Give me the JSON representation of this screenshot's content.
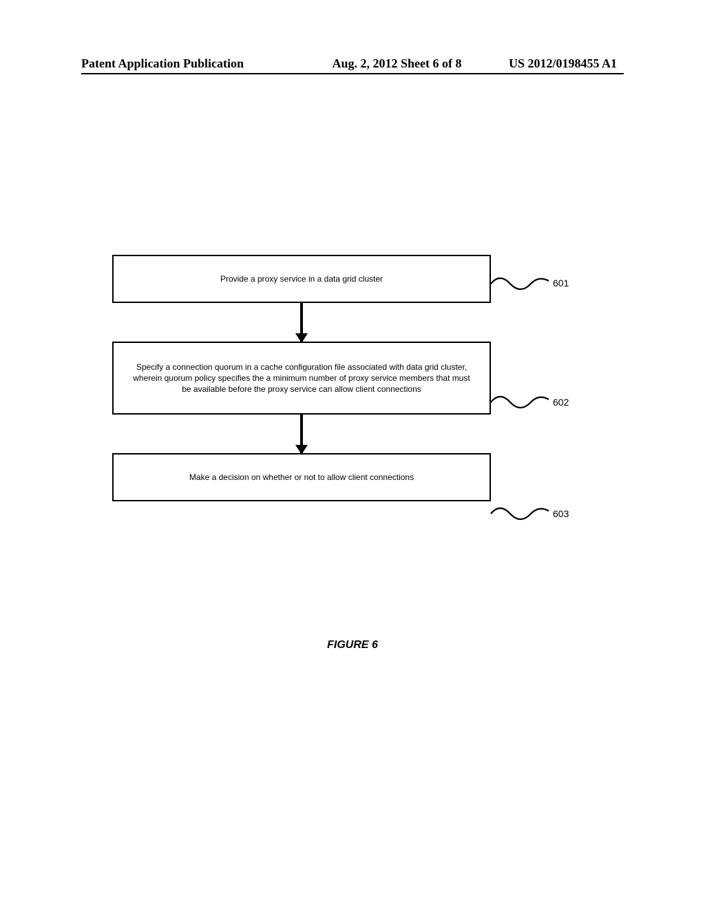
{
  "header": {
    "left": "Patent Application Publication",
    "center": "Aug. 2, 2012 Sheet 6 of 8",
    "right": "US 2012/0198455 A1"
  },
  "boxes": {
    "b1": "Provide a proxy service  in a data grid cluster",
    "b2": "Specify a connection quorum in a cache configuration file associated with data grid cluster, wherein quorum policy specifies the a minimum number of proxy service members that must be available before the proxy service can allow client connections",
    "b3": "Make a decision on whether or not to allow client connections"
  },
  "labels": {
    "l601": "601",
    "l602": "602",
    "l603": "603"
  },
  "caption": "FIGURE 6"
}
